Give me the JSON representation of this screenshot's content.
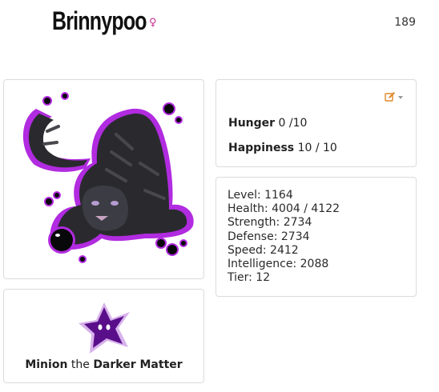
{
  "pet": {
    "name": "Brinnypoo",
    "gender_icon": "female-icon",
    "gender_symbol": "♀",
    "id": "189"
  },
  "needs": {
    "hunger_label": "Hunger",
    "hunger_value": "0 /10",
    "happiness_label": "Happiness",
    "happiness_value": "10 / 10",
    "edit_icon": "edit-icon"
  },
  "stats": [
    "Level: 1164",
    "Health: 4004 / 4122",
    "Strength: 2734",
    "Defense: 2734",
    "Speed: 2412",
    "Intelligence: 2088",
    "Tier: 12"
  ],
  "minion": {
    "name": "Minion",
    "joiner": "the",
    "title": "Darker Matter"
  },
  "colors": {
    "accent_purple": "#b12be0",
    "gender_pink": "#cc2d8c",
    "edit_orange": "#e0872a",
    "panel_border": "#dcdcdc"
  }
}
